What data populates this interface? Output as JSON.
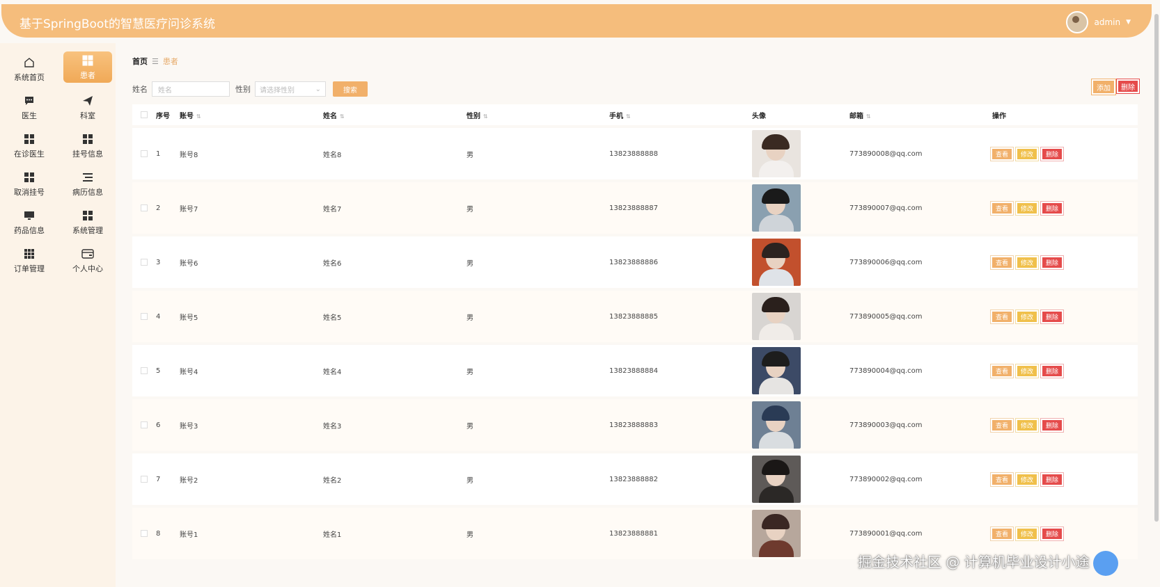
{
  "header": {
    "title": "基于SpringBoot的智慧医疗问诊系统",
    "username": "admin"
  },
  "sidebar": {
    "items": [
      {
        "label": "系统首页",
        "icon": "home-icon"
      },
      {
        "label": "患者",
        "icon": "grid-icon",
        "active": true
      },
      {
        "label": "医生",
        "icon": "chat-icon"
      },
      {
        "label": "科室",
        "icon": "send-icon"
      },
      {
        "label": "在诊医生",
        "icon": "grid-icon"
      },
      {
        "label": "挂号信息",
        "icon": "grid-icon"
      },
      {
        "label": "取消挂号",
        "icon": "grid-icon"
      },
      {
        "label": "病历信息",
        "icon": "list-icon"
      },
      {
        "label": "药品信息",
        "icon": "monitor-icon"
      },
      {
        "label": "系统管理",
        "icon": "grid-icon"
      },
      {
        "label": "订单管理",
        "icon": "apps-icon"
      },
      {
        "label": "个人中心",
        "icon": "wallet-icon"
      }
    ]
  },
  "breadcrumb": {
    "home": "首页",
    "current": "患者"
  },
  "search": {
    "name_label": "姓名",
    "name_placeholder": "姓名",
    "gender_label": "性别",
    "gender_placeholder": "请选择性别",
    "search_button": "搜索"
  },
  "actions": {
    "add": "添加",
    "delete": "删除"
  },
  "table": {
    "headers": [
      "序号",
      "账号",
      "姓名",
      "性别",
      "手机",
      "头像",
      "邮箱",
      "操作"
    ],
    "row_actions": {
      "view": "查看",
      "edit": "修改",
      "delete": "删除"
    },
    "rows": [
      {
        "no": "1",
        "account": "账号8",
        "name": "姓名8",
        "gender": "男",
        "phone": "13823888888",
        "email": "773890008@qq.com"
      },
      {
        "no": "2",
        "account": "账号7",
        "name": "姓名7",
        "gender": "男",
        "phone": "13823888887",
        "email": "773890007@qq.com"
      },
      {
        "no": "3",
        "account": "账号6",
        "name": "姓名6",
        "gender": "男",
        "phone": "13823888886",
        "email": "773890006@qq.com"
      },
      {
        "no": "4",
        "account": "账号5",
        "name": "姓名5",
        "gender": "男",
        "phone": "13823888885",
        "email": "773890005@qq.com"
      },
      {
        "no": "5",
        "account": "账号4",
        "name": "姓名4",
        "gender": "男",
        "phone": "13823888884",
        "email": "773890004@qq.com"
      },
      {
        "no": "6",
        "account": "账号3",
        "name": "姓名3",
        "gender": "男",
        "phone": "13823888883",
        "email": "773890003@qq.com"
      },
      {
        "no": "7",
        "account": "账号2",
        "name": "姓名2",
        "gender": "男",
        "phone": "13823888882",
        "email": "773890002@qq.com"
      },
      {
        "no": "8",
        "account": "账号1",
        "name": "姓名1",
        "gender": "男",
        "phone": "13823888881",
        "email": "773890001@qq.com"
      }
    ]
  },
  "watermark": "掘金技术社区 @ 计算机毕业设计小途",
  "colors": {
    "accent": "#f5bd7c",
    "danger": "#e54b4b",
    "warning": "#f0c04b"
  }
}
